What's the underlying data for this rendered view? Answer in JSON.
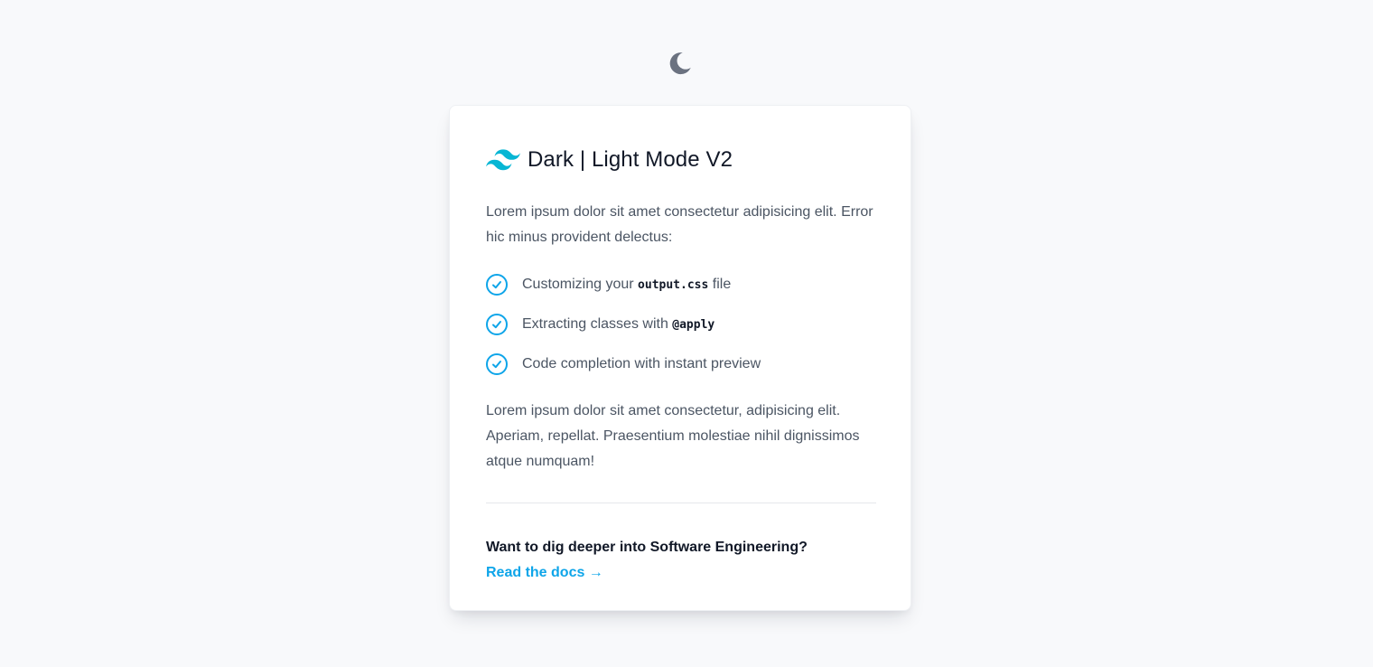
{
  "theme_toggle": {
    "icon": "moon-icon",
    "color": "#6b7280"
  },
  "card": {
    "logo": "tailwind-logo-icon",
    "title": "Dark | Light Mode V2",
    "intro": "Lorem ipsum dolor sit amet consectetur adipisicing elit. Error hic minus provident delectus:",
    "features": [
      {
        "text": "Customizing your ",
        "code": "output.css",
        "suffix": " file"
      },
      {
        "text": "Extracting classes with ",
        "code": "@apply",
        "suffix": ""
      },
      {
        "text": "Code completion with instant preview",
        "code": "",
        "suffix": ""
      }
    ],
    "outro": "Lorem ipsum dolor sit amet consectetur, adipisicing elit. Aperiam, repellat. Praesentium molestiae nihil dignissimos atque numquam!",
    "cta_text": "Want to dig deeper into Software Engineering?",
    "cta_link": "Read the docs →"
  },
  "colors": {
    "accent": "#0ea5e9",
    "logo": "#06b6d4",
    "background": "#f8f9fb"
  }
}
